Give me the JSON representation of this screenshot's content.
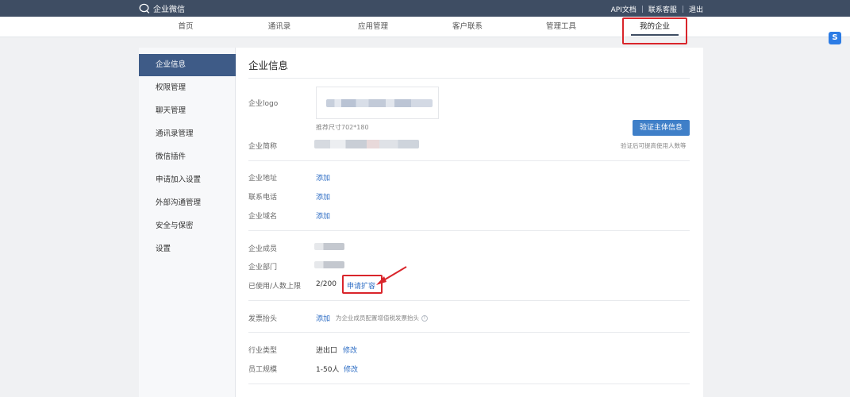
{
  "topbar": {
    "brand": "企业微信",
    "links": [
      "API文档",
      "联系客服",
      "退出"
    ]
  },
  "nav": {
    "items": [
      "首页",
      "通讯录",
      "应用管理",
      "客户联系",
      "管理工具",
      "我的企业"
    ],
    "active": "我的企业"
  },
  "sidebar": {
    "items": [
      "企业信息",
      "权限管理",
      "聊天管理",
      "通讯录管理",
      "微信插件",
      "申请加入设置",
      "外部沟通管理",
      "安全与保密",
      "设置"
    ],
    "active": "企业信息"
  },
  "main": {
    "title": "企业信息",
    "logo_label": "企业logo",
    "logo_hint": "推荐尺寸702*180",
    "short_name_label": "企业简称",
    "verify_button": "验证主体信息",
    "verify_hint": "验证后可提高使用人数等",
    "address_label": "企业地址",
    "phone_label": "联系电话",
    "domain_label": "企业域名",
    "add_link": "添加",
    "members_label": "企业成员",
    "departments_label": "企业部门",
    "usage_label": "已使用/人数上限",
    "usage_value": "2/200",
    "expand_link": "申请扩容",
    "invoice_label": "发票抬头",
    "invoice_hint": "为企业成员配置增值税发票抬头",
    "industry_label": "行业类型",
    "industry_value": "进出口",
    "scale_label": "员工规模",
    "scale_value": "1-50人",
    "modify_link": "修改",
    "info_icon_glyph": "!"
  },
  "colors": {
    "topbar": "#3e4d63",
    "sidebar_active": "#3e5b87",
    "link": "#2c6cc4",
    "primary_button": "#3f7fc8",
    "annotation_red": "#d9252b"
  }
}
